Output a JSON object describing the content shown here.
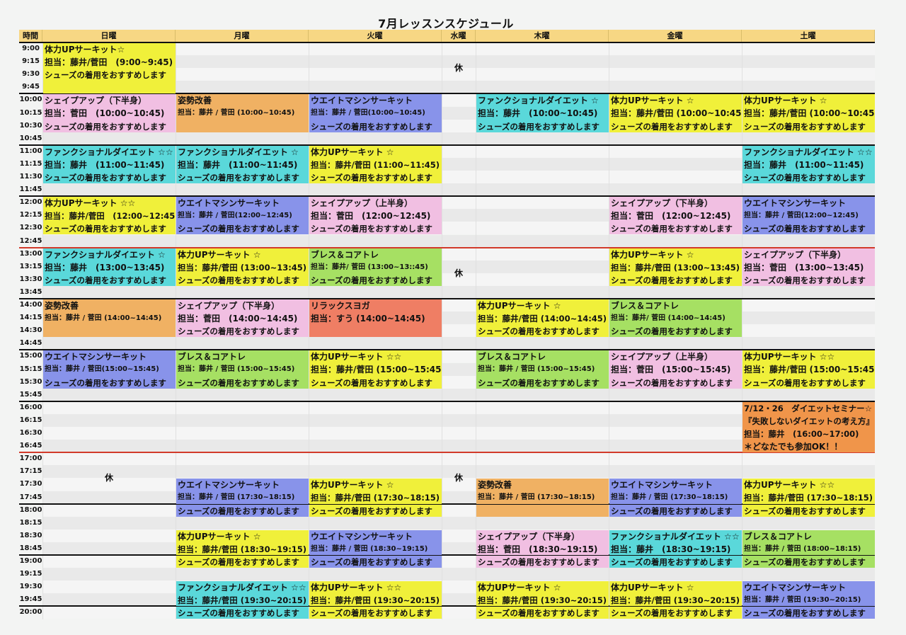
{
  "title": "7月レッスンスケジュール",
  "headers": [
    "時間",
    "日曜",
    "月曜",
    "火曜",
    "水曜",
    "木曜",
    "金曜",
    "土曜"
  ],
  "times": [
    "9:00",
    "9:15",
    "9:30",
    "9:45",
    "10:00",
    "10:15",
    "10:30",
    "10:45",
    "11:00",
    "11:15",
    "11:30",
    "11:45",
    "12:00",
    "12:15",
    "12:30",
    "12:45",
    "13:00",
    "13:15",
    "13:30",
    "13:45",
    "14:00",
    "14:15",
    "14:30",
    "14:45",
    "15:00",
    "15:15",
    "15:30",
    "15:45",
    "16:00",
    "16:15",
    "16:30",
    "16:45",
    "17:00",
    "17:15",
    "17:30",
    "17:45",
    "18:00",
    "18:15",
    "18:30",
    "18:45",
    "19:00",
    "19:15",
    "19:30",
    "19:45",
    "20:00"
  ],
  "colors": {
    "yellow": "#f0f03a",
    "pink": "#f1bfe2",
    "orange": "#f0b163",
    "blue": "#8893ea",
    "cyan": "#5ad8da",
    "green": "#a6e063",
    "red": "#ef7e64",
    "deeporange": "#f0954a"
  },
  "closed_label": "休",
  "closed": [
    {
      "day": 4,
      "rows": [
        0,
        4
      ]
    },
    {
      "day": 4,
      "rows": [
        16,
        4
      ]
    },
    {
      "day": 1,
      "rows": [
        32,
        4
      ]
    },
    {
      "day": 4,
      "rows": [
        32,
        4
      ]
    }
  ],
  "classes": [
    {
      "day": 1,
      "row": 0,
      "color": "yellow",
      "lines": [
        {
          "t": "体力UPサーキット☆",
          "s": "b"
        },
        {
          "t": "担当：藤井/菅田　(9:00~9:45)",
          "s": "b"
        },
        {
          "t": "シューズの着用をおすすめします",
          "s": "m"
        },
        {
          "t": "",
          "s": "x"
        }
      ]
    },
    {
      "day": 1,
      "row": 4,
      "color": "pink",
      "lines": [
        {
          "t": "シェイプアップ（下半身）",
          "s": "b"
        },
        {
          "t": "担当：菅田　(10:00~10:45)",
          "s": "b"
        },
        {
          "t": "シューズの着用をおすすめします",
          "s": "m"
        }
      ]
    },
    {
      "day": 2,
      "row": 4,
      "color": "orange",
      "lines": [
        {
          "t": "姿勢改善",
          "s": "b"
        },
        {
          "t": "担当：藤井 / 菅田 (10:00~10:45)",
          "s": "s"
        },
        {
          "t": "",
          "s": "x"
        }
      ]
    },
    {
      "day": 3,
      "row": 4,
      "color": "blue",
      "lines": [
        {
          "t": "ウエイトマシンサーキット",
          "s": "b"
        },
        {
          "t": "担当：藤井 / 菅田(10:00~10:45)",
          "s": "s"
        },
        {
          "t": "シューズの着用をおすすめします",
          "s": "m"
        }
      ]
    },
    {
      "day": 5,
      "row": 4,
      "color": "cyan",
      "lines": [
        {
          "t": "ファンクショナルダイエット ☆",
          "s": "b"
        },
        {
          "t": "担当：藤井　(10:00~10:45)",
          "s": "b"
        },
        {
          "t": "シューズの着用をおすすめします",
          "s": "m"
        }
      ]
    },
    {
      "day": 6,
      "row": 4,
      "color": "yellow",
      "lines": [
        {
          "t": "体力UPサーキット ☆",
          "s": "b"
        },
        {
          "t": "担当：藤井/菅田 (10:00~10:45)",
          "s": "b"
        },
        {
          "t": "シューズの着用をおすすめします",
          "s": "m"
        }
      ]
    },
    {
      "day": 7,
      "row": 4,
      "color": "yellow",
      "lines": [
        {
          "t": "体力UPサーキット ☆",
          "s": "b"
        },
        {
          "t": "担当：藤井/菅田 (10:00~10:45)",
          "s": "b"
        },
        {
          "t": "シューズの着用をおすすめします",
          "s": "m"
        }
      ]
    },
    {
      "day": 1,
      "row": 8,
      "color": "cyan",
      "lines": [
        {
          "t": "ファンクショナルダイエット ☆☆",
          "s": "b"
        },
        {
          "t": "担当：藤井　(11:00~11:45)",
          "s": "b"
        },
        {
          "t": "シューズの着用をおすすめします",
          "s": "m"
        }
      ]
    },
    {
      "day": 2,
      "row": 8,
      "color": "cyan",
      "lines": [
        {
          "t": "ファンクショナルダイエット ☆",
          "s": "b"
        },
        {
          "t": "担当：藤井　(11:00~11:45)",
          "s": "b"
        },
        {
          "t": "シューズの着用をおすすめします",
          "s": "m"
        }
      ]
    },
    {
      "day": 3,
      "row": 8,
      "color": "yellow",
      "lines": [
        {
          "t": "体力UPサーキット ☆",
          "s": "b"
        },
        {
          "t": "担当：藤井/菅田 (11:00~11:45)",
          "s": "m"
        },
        {
          "t": "シューズの着用をおすすめします",
          "s": "m"
        }
      ]
    },
    {
      "day": 7,
      "row": 8,
      "color": "cyan",
      "lines": [
        {
          "t": "ファンクショナルダイエット ☆☆",
          "s": "b"
        },
        {
          "t": "担当：藤井　(11:00~11:45)",
          "s": "b"
        },
        {
          "t": "シューズの着用をおすすめします",
          "s": "m"
        }
      ]
    },
    {
      "day": 1,
      "row": 12,
      "color": "yellow",
      "lines": [
        {
          "t": "体力UPサーキット ☆☆",
          "s": "b"
        },
        {
          "t": "担当：藤井/菅田　(12:00~12:45)",
          "s": "m"
        },
        {
          "t": "シューズの着用をおすすめします",
          "s": "m"
        }
      ]
    },
    {
      "day": 2,
      "row": 12,
      "color": "blue",
      "lines": [
        {
          "t": "ウエイトマシンサーキット",
          "s": "b"
        },
        {
          "t": "担当：藤井 / 菅田(12:00~12:45)",
          "s": "s"
        },
        {
          "t": "シューズの着用をおすすめします",
          "s": "m"
        }
      ]
    },
    {
      "day": 3,
      "row": 12,
      "color": "pink",
      "lines": [
        {
          "t": "シェイプアップ（上半身）",
          "s": "b"
        },
        {
          "t": "担当：菅田　(12:00~12:45)",
          "s": "b"
        },
        {
          "t": "シューズの着用をおすすめします",
          "s": "m"
        }
      ]
    },
    {
      "day": 6,
      "row": 12,
      "color": "pink",
      "lines": [
        {
          "t": "シェイプアップ（下半身）",
          "s": "b"
        },
        {
          "t": "担当：菅田　(12:00~12:45)",
          "s": "b"
        },
        {
          "t": "シューズの着用をおすすめします",
          "s": "m"
        }
      ]
    },
    {
      "day": 7,
      "row": 12,
      "color": "blue",
      "lines": [
        {
          "t": "ウエイトマシンサーキット",
          "s": "b"
        },
        {
          "t": "担当：藤井 / 菅田(12:00~12:45)",
          "s": "s"
        },
        {
          "t": "シューズの着用をおすすめします",
          "s": "m"
        }
      ]
    },
    {
      "day": 1,
      "row": 16,
      "color": "cyan",
      "lines": [
        {
          "t": "ファンクショナルダイエット ☆",
          "s": "b"
        },
        {
          "t": "担当：藤井　(13:00~13:45)",
          "s": "b"
        },
        {
          "t": "シューズの着用をおすすめします",
          "s": "m"
        }
      ]
    },
    {
      "day": 2,
      "row": 16,
      "color": "yellow",
      "lines": [
        {
          "t": "体力UPサーキット ☆",
          "s": "b"
        },
        {
          "t": "担当：藤井/菅田 (13:00~13:45)",
          "s": "m"
        },
        {
          "t": "シューズの着用をおすすめします",
          "s": "m"
        }
      ]
    },
    {
      "day": 3,
      "row": 16,
      "color": "green",
      "lines": [
        {
          "t": "ブレス＆コアトレ",
          "s": "b"
        },
        {
          "t": "担当：藤井/ 菅田 (13:00~13::45)",
          "s": "s"
        },
        {
          "t": "シューズの着用をおすすめします",
          "s": "m"
        }
      ]
    },
    {
      "day": 6,
      "row": 16,
      "color": "yellow",
      "lines": [
        {
          "t": "体力UPサーキット ☆",
          "s": "b"
        },
        {
          "t": "担当：藤井/菅田 (13:00~13:45)",
          "s": "m"
        },
        {
          "t": "シューズの着用をおすすめします",
          "s": "m"
        }
      ]
    },
    {
      "day": 7,
      "row": 16,
      "color": "pink",
      "lines": [
        {
          "t": "シェイプアップ（下半身）",
          "s": "b"
        },
        {
          "t": "担当：菅田　(13:00~13:45)",
          "s": "b"
        },
        {
          "t": "シューズの着用をおすすめします",
          "s": "m"
        }
      ]
    },
    {
      "day": 1,
      "row": 20,
      "color": "orange",
      "lines": [
        {
          "t": "姿勢改善",
          "s": "b"
        },
        {
          "t": "担当：藤井 / 菅田 (14:00~14:45)",
          "s": "s"
        },
        {
          "t": "",
          "s": "x"
        }
      ]
    },
    {
      "day": 2,
      "row": 20,
      "color": "pink",
      "lines": [
        {
          "t": "シェイプアップ（下半身）",
          "s": "b"
        },
        {
          "t": "担当：菅田　(14:00~14:45)",
          "s": "b"
        },
        {
          "t": "シューズの着用をおすすめします",
          "s": "m"
        }
      ]
    },
    {
      "day": 3,
      "row": 20,
      "color": "red",
      "lines": [
        {
          "t": "リラックスヨガ",
          "s": "b"
        },
        {
          "t": "担当：すう (14:00~14:45)",
          "s": "b"
        },
        {
          "t": "",
          "s": "x"
        }
      ]
    },
    {
      "day": 5,
      "row": 20,
      "color": "yellow",
      "lines": [
        {
          "t": "体力UPサーキット ☆",
          "s": "b"
        },
        {
          "t": "担当：藤井/菅田 (14:00~14:45)",
          "s": "m"
        },
        {
          "t": "シューズの着用をおすすめします",
          "s": "m"
        }
      ]
    },
    {
      "day": 6,
      "row": 20,
      "color": "green",
      "lines": [
        {
          "t": "ブレス＆コアトレ",
          "s": "b"
        },
        {
          "t": "担当：藤井/ 菅田 (14:00~14:45)",
          "s": "s"
        },
        {
          "t": "シューズの着用をおすすめします",
          "s": "m"
        }
      ]
    },
    {
      "day": 1,
      "row": 24,
      "color": "blue",
      "lines": [
        {
          "t": "ウエイトマシンサーキット",
          "s": "b"
        },
        {
          "t": "担当：藤井 / 菅田(15:00~15:45)",
          "s": "s"
        },
        {
          "t": "シューズの着用をおすすめします",
          "s": "m"
        }
      ]
    },
    {
      "day": 2,
      "row": 24,
      "color": "green",
      "lines": [
        {
          "t": "ブレス＆コアトレ",
          "s": "b"
        },
        {
          "t": "担当：藤井 / 菅田 (15:00~15:45)",
          "s": "s"
        },
        {
          "t": "シューズの着用をおすすめします",
          "s": "m"
        }
      ]
    },
    {
      "day": 3,
      "row": 24,
      "color": "yellow",
      "lines": [
        {
          "t": "体力UPサーキット ☆☆",
          "s": "b"
        },
        {
          "t": "担当：藤井/菅田 (15:00~15:45)",
          "s": "b"
        },
        {
          "t": "シューズの着用をおすすめします",
          "s": "m"
        }
      ]
    },
    {
      "day": 5,
      "row": 24,
      "color": "green",
      "lines": [
        {
          "t": "ブレス＆コアトレ",
          "s": "b"
        },
        {
          "t": "担当：藤井 / 菅田 (15:00~15:45)",
          "s": "s"
        },
        {
          "t": "シューズの着用をおすすめします",
          "s": "m"
        }
      ]
    },
    {
      "day": 6,
      "row": 24,
      "color": "pink",
      "lines": [
        {
          "t": "シェイプアップ（上半身）",
          "s": "b"
        },
        {
          "t": "担当：菅田　(15:00~15:45)",
          "s": "b"
        },
        {
          "t": "シューズの着用をおすすめします",
          "s": "m"
        }
      ]
    },
    {
      "day": 7,
      "row": 24,
      "color": "yellow",
      "lines": [
        {
          "t": "体力UPサーキット ☆☆",
          "s": "b"
        },
        {
          "t": "担当：藤井/菅田 (15:00~15:45)",
          "s": "b"
        },
        {
          "t": "シューズの着用をおすすめします",
          "s": "m"
        }
      ]
    },
    {
      "day": 7,
      "row": 28,
      "color": "deeporange",
      "lines": [
        {
          "t": "7/12・26　ダイエットセミナー☆",
          "s": "m"
        },
        {
          "t": "『失敗しないダイエットの考え方』",
          "s": "m"
        },
        {
          "t": "担当：藤井　(16:00~17:00)",
          "s": "m"
        },
        {
          "t": "＊どなたでも参加OK！！",
          "s": "b"
        }
      ]
    },
    {
      "day": 2,
      "row": 34,
      "color": "blue",
      "lines": [
        {
          "t": "ウエイトマシンサーキット",
          "s": "b"
        },
        {
          "t": "担当：藤井 / 菅田 (17:30~18:15)",
          "s": "s"
        }
      ]
    },
    {
      "day": 3,
      "row": 34,
      "color": "yellow",
      "lines": [
        {
          "t": "体力UPサーキット ☆",
          "s": "b"
        },
        {
          "t": "担当：藤井/菅田 (17:30~18:15)",
          "s": "m"
        }
      ]
    },
    {
      "day": 5,
      "row": 34,
      "color": "orange",
      "lines": [
        {
          "t": "姿勢改善",
          "s": "b"
        },
        {
          "t": "担当：藤井 / 菅田 (17:30~18:15)",
          "s": "s"
        }
      ]
    },
    {
      "day": 6,
      "row": 34,
      "color": "blue",
      "lines": [
        {
          "t": "ウエイトマシンサーキット",
          "s": "b"
        },
        {
          "t": "担当：藤井 / 菅田 (17:30~18:15)",
          "s": "s"
        }
      ]
    },
    {
      "day": 7,
      "row": 34,
      "color": "yellow",
      "lines": [
        {
          "t": "体力UPサーキット ☆☆",
          "s": "b"
        },
        {
          "t": "担当：藤井/菅田 (17:30~18:15)",
          "s": "m"
        }
      ]
    },
    {
      "day": 2,
      "row": 36,
      "color": "blue",
      "lines": [
        {
          "t": "シューズの着用をおすすめします",
          "s": "m"
        }
      ]
    },
    {
      "day": 3,
      "row": 36,
      "color": "yellow",
      "lines": [
        {
          "t": "シューズの着用をおすすめします",
          "s": "m"
        }
      ]
    },
    {
      "day": 5,
      "row": 36,
      "color": "orange",
      "lines": [
        {
          "t": "",
          "s": "x"
        }
      ]
    },
    {
      "day": 6,
      "row": 36,
      "color": "blue",
      "lines": [
        {
          "t": "シューズの着用をおすすめします",
          "s": "m"
        }
      ]
    },
    {
      "day": 7,
      "row": 36,
      "color": "yellow",
      "lines": [
        {
          "t": "シューズの着用をおすすめします",
          "s": "m"
        }
      ]
    },
    {
      "day": 2,
      "row": 38,
      "color": "yellow",
      "lines": [
        {
          "t": "体力UPサーキット ☆",
          "s": "b"
        },
        {
          "t": "担当：藤井/菅田 (18:30~19:15)",
          "s": "m"
        }
      ]
    },
    {
      "day": 3,
      "row": 38,
      "color": "blue",
      "lines": [
        {
          "t": "ウエイトマシンサーキット",
          "s": "b"
        },
        {
          "t": "担当：藤井 / 菅田 (18:30~19:15)",
          "s": "s"
        }
      ]
    },
    {
      "day": 5,
      "row": 38,
      "color": "pink",
      "lines": [
        {
          "t": "シェイプアップ（下半身）",
          "s": "b"
        },
        {
          "t": "担当：菅田　(18:30~19:15)",
          "s": "b"
        }
      ]
    },
    {
      "day": 6,
      "row": 38,
      "color": "cyan",
      "lines": [
        {
          "t": "ファンクショナルダイエット ☆☆",
          "s": "b"
        },
        {
          "t": "担当：藤井　(18:30~19:15)",
          "s": "b"
        }
      ]
    },
    {
      "day": 7,
      "row": 38,
      "color": "green",
      "lines": [
        {
          "t": "ブレス＆コアトレ",
          "s": "b"
        },
        {
          "t": "担当：藤井 / 菅田 (18:00~18:15)",
          "s": "s"
        }
      ]
    },
    {
      "day": 2,
      "row": 40,
      "color": "yellow",
      "lines": [
        {
          "t": "シューズの着用をおすすめします",
          "s": "m"
        }
      ]
    },
    {
      "day": 3,
      "row": 40,
      "color": "blue",
      "lines": [
        {
          "t": "シューズの着用をおすすめします",
          "s": "m"
        }
      ]
    },
    {
      "day": 5,
      "row": 40,
      "color": "pink",
      "lines": [
        {
          "t": "シューズの着用をおすすめします",
          "s": "m"
        }
      ]
    },
    {
      "day": 6,
      "row": 40,
      "color": "cyan",
      "lines": [
        {
          "t": "シューズの着用をおすすめします",
          "s": "m"
        }
      ]
    },
    {
      "day": 7,
      "row": 40,
      "color": "green",
      "lines": [
        {
          "t": "シューズの着用をおすすめします",
          "s": "m"
        }
      ]
    },
    {
      "day": 2,
      "row": 42,
      "color": "cyan",
      "lines": [
        {
          "t": "ファンクショナルダイエット ☆☆",
          "s": "b"
        },
        {
          "t": "担当：藤井/菅田 (19:30~20:15)",
          "s": "m"
        }
      ]
    },
    {
      "day": 3,
      "row": 42,
      "color": "yellow",
      "lines": [
        {
          "t": "体力UPサーキット ☆☆",
          "s": "b"
        },
        {
          "t": "担当：藤井/菅田 (19:30~20:15)",
          "s": "m"
        }
      ]
    },
    {
      "day": 5,
      "row": 42,
      "color": "yellow",
      "lines": [
        {
          "t": "体力UPサーキット ☆",
          "s": "b"
        },
        {
          "t": "担当：藤井/菅田 (19:30~20:15)",
          "s": "m"
        }
      ]
    },
    {
      "day": 6,
      "row": 42,
      "color": "yellow",
      "lines": [
        {
          "t": "体力UPサーキット ☆",
          "s": "b"
        },
        {
          "t": "担当：藤井/菅田 (19:30~20:15)",
          "s": "m"
        }
      ]
    },
    {
      "day": 7,
      "row": 42,
      "color": "blue",
      "lines": [
        {
          "t": "ウエイトマシンサーキット",
          "s": "b"
        },
        {
          "t": "担当：藤井 / 菅田 (19:30~20:15)",
          "s": "s"
        }
      ]
    },
    {
      "day": 2,
      "row": 44,
      "color": "cyan",
      "lines": [
        {
          "t": "シューズの着用をおすすめします",
          "s": "m"
        }
      ]
    },
    {
      "day": 3,
      "row": 44,
      "color": "yellow",
      "lines": [
        {
          "t": "シューズの着用をおすすめします",
          "s": "m"
        }
      ]
    },
    {
      "day": 5,
      "row": 44,
      "color": "yellow",
      "lines": [
        {
          "t": "シューズの着用をおすすめします",
          "s": "m"
        }
      ]
    },
    {
      "day": 6,
      "row": 44,
      "color": "yellow",
      "lines": [
        {
          "t": "シューズの着用をおすすめします",
          "s": "m"
        }
      ]
    },
    {
      "day": 7,
      "row": 44,
      "color": "blue",
      "lines": [
        {
          "t": "シューズの着用をおすすめします",
          "s": "m"
        }
      ]
    }
  ]
}
